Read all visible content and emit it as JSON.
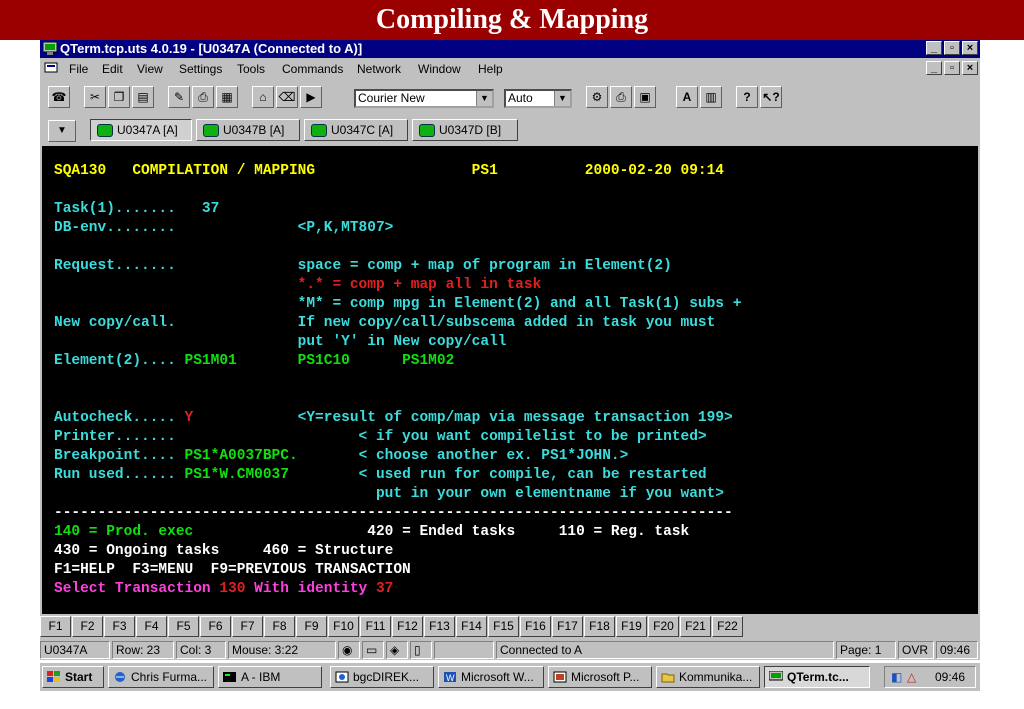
{
  "slide": {
    "title": "Compiling & Mapping"
  },
  "window": {
    "title": "QTerm.tcp.uts 4.0.19 - [U0347A (Connected to A)]",
    "controls": {
      "minimize": "_",
      "maximize": "▫",
      "close": "×"
    }
  },
  "menu": [
    "File",
    "Edit",
    "View",
    "Settings",
    "Tools",
    "Commands",
    "Network",
    "Window",
    "Help"
  ],
  "toolbar": {
    "font": "Courier New",
    "size": "Auto",
    "bold_label": "A"
  },
  "sessions": [
    "U0347A [A]",
    "U0347B [A]",
    "U0347C [A]",
    "U0347D [B]"
  ],
  "terminal": {
    "lines": [
      [
        {
          "t": "SQA130   COMPILATION / MAPPING                  PS1          2000-02-20 09:14",
          "c": "y"
        }
      ],
      [],
      [
        {
          "t": "Task(1).......   37",
          "c": "c"
        }
      ],
      [
        {
          "t": "DB-env........              <P,K,MT807>",
          "c": "c"
        }
      ],
      [],
      [
        {
          "t": "Request.......              space = comp + map of program in Element(2)",
          "c": "c"
        }
      ],
      [
        {
          "t": "                            *.* = comp + map all in task",
          "c": "r"
        }
      ],
      [
        {
          "t": "                            *M* = comp mpg in Element(2) and all Task(1) subs +",
          "c": "c"
        }
      ],
      [
        {
          "t": "New copy/call.              If new copy/call/subscema added in task you must",
          "c": "c"
        }
      ],
      [
        {
          "t": "                            put 'Y' in New copy/call",
          "c": "c"
        }
      ],
      [
        {
          "t": "Element(2).... ",
          "c": "c"
        },
        {
          "t": "PS1M01       PS1C10      PS1M02",
          "c": "g"
        }
      ],
      [],
      [],
      [
        {
          "t": "Autocheck..... ",
          "c": "c"
        },
        {
          "t": "Y",
          "c": "r"
        },
        {
          "t": "            <Y=result of comp/map via message transaction 199>",
          "c": "c"
        }
      ],
      [
        {
          "t": "Printer.......                     < if you want compilelist to be printed>",
          "c": "c"
        }
      ],
      [
        {
          "t": "Breakpoint.... ",
          "c": "c"
        },
        {
          "t": "PS1*A0037BPC.",
          "c": "g"
        },
        {
          "t": "       < choose another ex. PS1*JOHN.>",
          "c": "c"
        }
      ],
      [
        {
          "t": "Run used...... ",
          "c": "c"
        },
        {
          "t": "PS1*W.CM0037",
          "c": "g"
        },
        {
          "t": "        < used run for compile, can be restarted",
          "c": "c"
        }
      ],
      [
        {
          "t": "                                     put in your own elementname if you want>",
          "c": "c"
        }
      ],
      [
        {
          "t": "------------------------------------------------------------------------------",
          "c": "w"
        }
      ],
      [
        {
          "t": "140 = Prod. exec",
          "c": "g"
        },
        {
          "t": "                    420 = Ended tasks     110 = Reg. task",
          "c": "w"
        }
      ],
      [
        {
          "t": "430 = Ongoing tasks     460 = Structure",
          "c": "w"
        }
      ],
      [
        {
          "t": "F1=HELP  F3=MENU  F9=PREVIOUS TRANSACTION",
          "c": "w"
        }
      ],
      [
        {
          "t": "Select Transaction ",
          "c": "m"
        },
        {
          "t": "130",
          "c": "r"
        },
        {
          "t": " With identity ",
          "c": "m"
        },
        {
          "t": "37",
          "c": "r"
        }
      ]
    ]
  },
  "fkeys": [
    "F1",
    "F2",
    "F3",
    "F4",
    "F5",
    "F6",
    "F7",
    "F8",
    "F9",
    "F10",
    "F11",
    "F12",
    "F13",
    "F14",
    "F15",
    "F16",
    "F17",
    "F18",
    "F19",
    "F20",
    "F21",
    "F22"
  ],
  "status": {
    "session": "U0347A",
    "row": "Row: 23",
    "col": "Col: 3",
    "mouse": "Mouse:  3:22",
    "connection": "Connected to A",
    "page": "Page: 1",
    "mode": "OVR",
    "time": "09:46"
  },
  "taskbar": {
    "start": "Start",
    "items": [
      "Chris Furma...",
      "A - IBM",
      "bgcDIREK...",
      "Microsoft W...",
      "Microsoft P...",
      "Kommunika...",
      "QTerm.tc..."
    ],
    "clock": "09:46"
  }
}
